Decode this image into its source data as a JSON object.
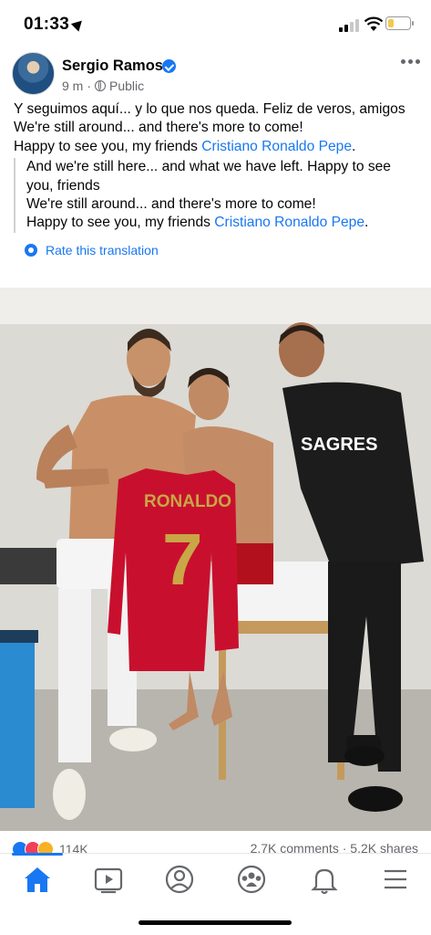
{
  "status_bar": {
    "time": "01:33",
    "battery_level": 0.3
  },
  "post": {
    "author": "Sergio Ramos",
    "time_ago": "9 m",
    "separator": "·",
    "audience": "Public",
    "text": {
      "line1": "Y seguimos aquí... y lo que nos queda. Feliz de veros, amigos",
      "line2": "We're still around... and there's more to come!",
      "line3_prefix": "Happy to see you, my friends ",
      "mention": "Cristiano Ronaldo Pepe",
      "line3_suffix": "."
    },
    "translation": {
      "line1": "And we're still here... and what we have left. Happy to see you, friends",
      "line2": "We're still around... and there's more to come!",
      "line3_prefix": "Happy to see you, my friends ",
      "mention": "Cristiano Ronaldo Pepe",
      "line3_suffix": "."
    },
    "rate_translation": "Rate this translation",
    "photo": {
      "jersey_name": "RONALDO",
      "jersey_number": "7",
      "shirt_text": "SAGRES"
    }
  },
  "engagement": {
    "reaction_count": "114K",
    "comments": "2.7K comments",
    "shares": "5.2K shares",
    "separator": "·"
  },
  "nav": {
    "items": [
      "home-icon",
      "video-icon",
      "profile-icon",
      "groups-icon",
      "bell-icon",
      "menu-icon"
    ],
    "active": "home-icon"
  },
  "colors": {
    "accent": "#1877f2",
    "jersey_red": "#c8102e",
    "jersey_gold": "#c9a646",
    "text_secondary": "#65676b"
  }
}
